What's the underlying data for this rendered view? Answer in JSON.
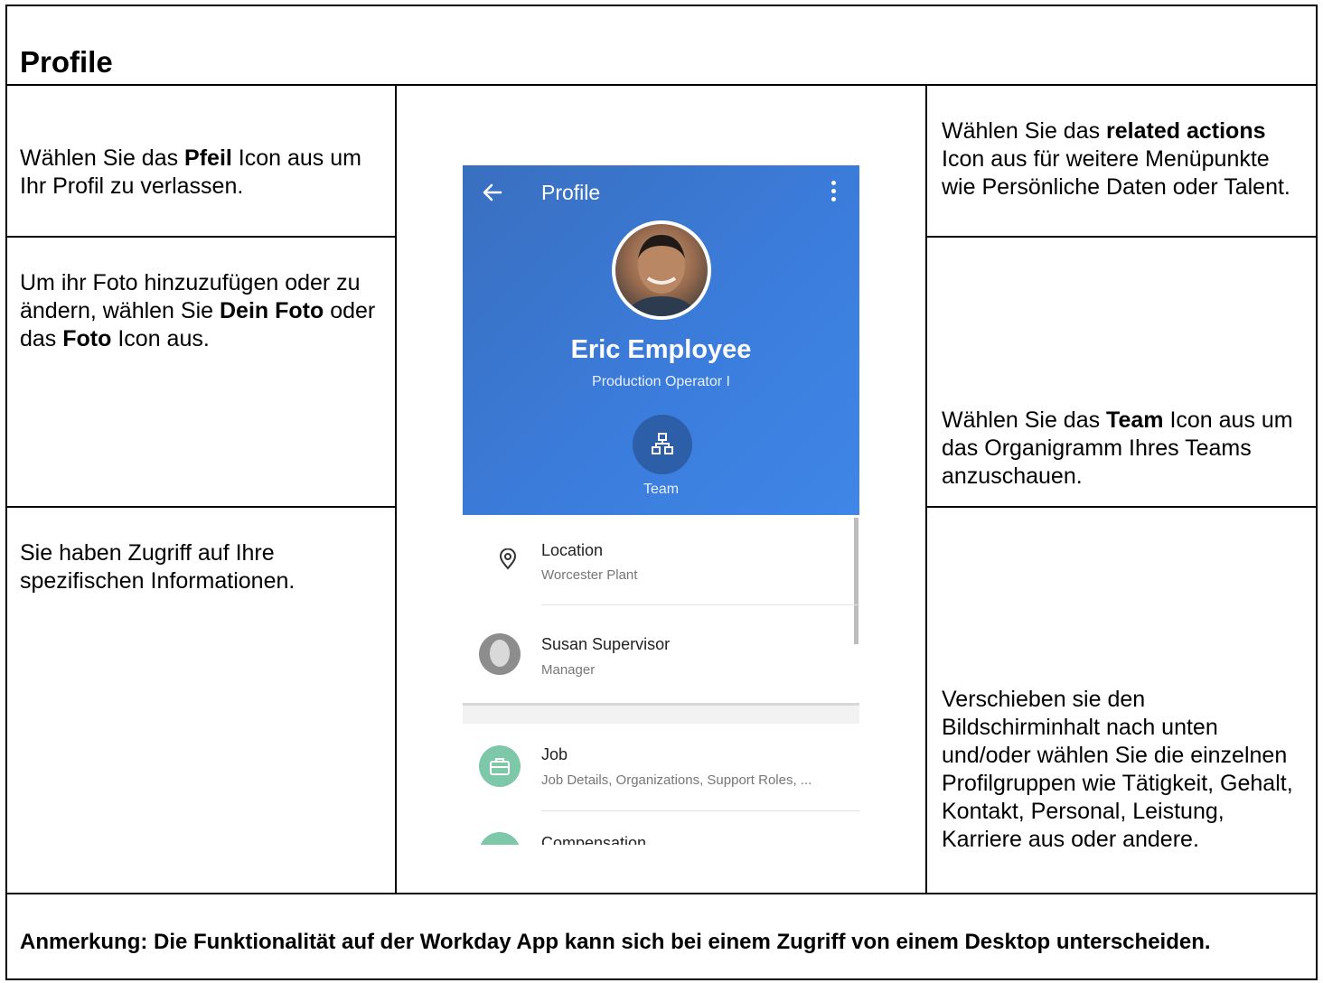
{
  "page": {
    "title": "Profile",
    "note": "Anmerkung: Die Funktionalität auf der Workday App kann sich bei einem Zugriff von einem Desktop unterscheiden."
  },
  "left": {
    "cell1": [
      "Wählen Sie das ",
      "Pfeil",
      " Icon aus um Ihr Profil zu verlassen."
    ],
    "cell2": [
      "Um ihr Foto hinzuzufügen oder zu ändern, wählen Sie ",
      "Dein Foto",
      " oder das ",
      "Foto",
      " Icon aus."
    ],
    "cell3": "Sie haben Zugriff auf Ihre spezifischen Informationen."
  },
  "right": {
    "cell1": [
      "Wählen Sie das ",
      "related actions",
      " Icon aus für weitere Menüpunkte wie Persönliche Daten oder Talent."
    ],
    "cell2": [
      "Wählen Sie das ",
      "Team",
      " Icon aus um das Organigramm Ihres Teams anzuschauen."
    ],
    "cell3": "Verschieben sie den Bildschirminhalt nach unten und/oder wählen Sie die einzelnen Profilgruppen wie Tätigkeit, Gehalt, Kontakt, Personal, Leistung, Karriere aus oder andere."
  },
  "phone": {
    "header_title": "Profile",
    "name": "Eric Employee",
    "role": "Production Operator I",
    "team_label": "Team",
    "rows": [
      {
        "title": "Location",
        "subtitle": "Worcester Plant"
      },
      {
        "title": "Susan Supervisor",
        "subtitle": "Manager"
      },
      {
        "title": "Job",
        "subtitle": "Job Details, Organizations, Support Roles, ..."
      },
      {
        "title": "Compensation",
        "subtitle": ""
      }
    ],
    "colors": {
      "header": "#3b7ddd",
      "team_button": "#2d5ea8",
      "job_icon": "#7cc8a8",
      "avatar_placeholder": "#8d8d8d"
    },
    "icons": [
      "back-arrow-icon",
      "more-vert-icon",
      "team-org-icon",
      "location-pin-icon",
      "briefcase-icon"
    ]
  }
}
